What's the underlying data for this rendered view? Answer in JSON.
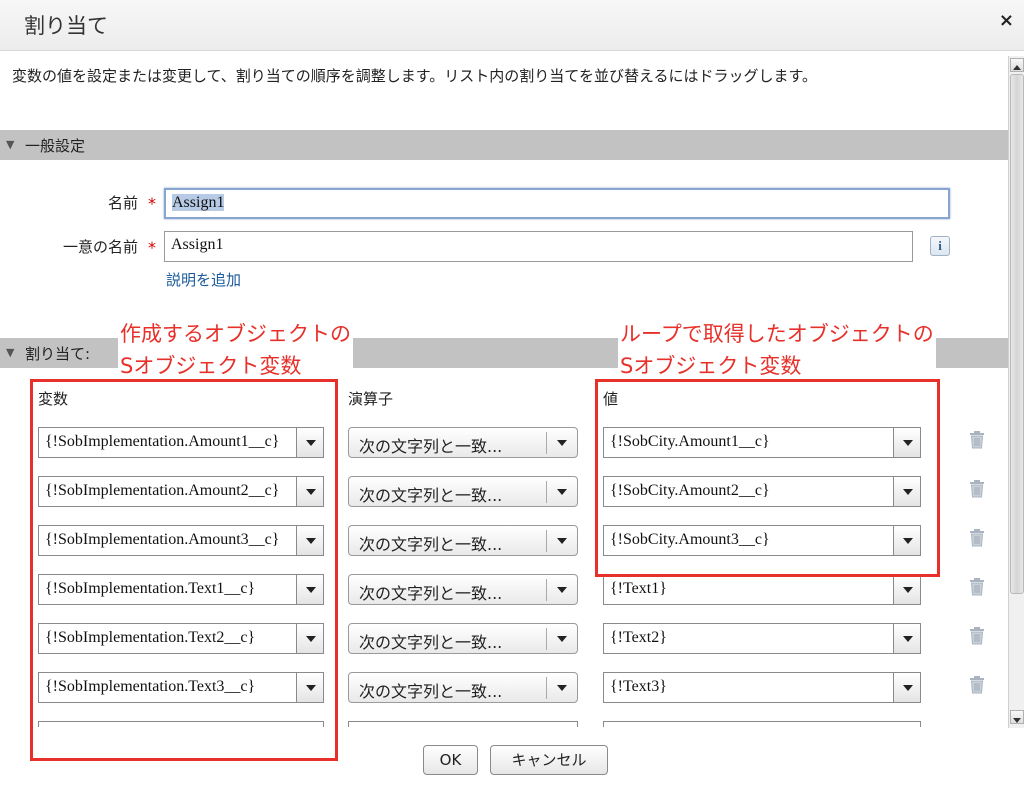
{
  "dialog": {
    "title": "割り当て",
    "close_label": "×",
    "description": "変数の値を設定または変更して、割り当ての順序を調整します。リスト内の割り当てを並び替えるにはドラッグします。"
  },
  "general": {
    "section_label": "一般設定",
    "name_label": "名前",
    "name_value": "Assign1",
    "unique_name_label": "一意の名前",
    "unique_name_value": "Assign1",
    "required_mark": "*",
    "info_label": "i",
    "add_description_link": "説明を追加"
  },
  "assignments": {
    "section_label": "割り当て:",
    "annotation_left": [
      "作成するオブジェクトの",
      "Sオブジェクト変数"
    ],
    "annotation_right": [
      "ループで取得したオブジェクトの",
      "Sオブジェクト変数"
    ],
    "col_variable": "変数",
    "col_operator": "演算子",
    "col_value": "値",
    "rows": [
      {
        "variable": "{!SobImplementation.Amount1__c}",
        "operator": "次の文字列と一致...",
        "value": "{!SobCity.Amount1__c}"
      },
      {
        "variable": "{!SobImplementation.Amount2__c}",
        "operator": "次の文字列と一致...",
        "value": "{!SobCity.Amount2__c}"
      },
      {
        "variable": "{!SobImplementation.Amount3__c}",
        "operator": "次の文字列と一致...",
        "value": "{!SobCity.Amount3__c}"
      },
      {
        "variable": "{!SobImplementation.Text1__c}",
        "operator": "次の文字列と一致...",
        "value": "{!Text1}"
      },
      {
        "variable": "{!SobImplementation.Text2__c}",
        "operator": "次の文字列と一致...",
        "value": "{!Text2}"
      },
      {
        "variable": "{!SobImplementation.Text3__c}",
        "operator": "次の文字列と一致...",
        "value": "{!Text3}"
      }
    ]
  },
  "footer": {
    "ok_label": "OK",
    "cancel_label": "キャンセル"
  },
  "colors": {
    "annotation_red": "#e8302a",
    "section_gray": "#c2c2c2",
    "link_blue": "#1a5a9c"
  },
  "icons": {
    "close": "close-icon",
    "collapse": "triangle-down-icon",
    "trash": "trash-icon",
    "dropdown": "chevron-down-icon"
  }
}
